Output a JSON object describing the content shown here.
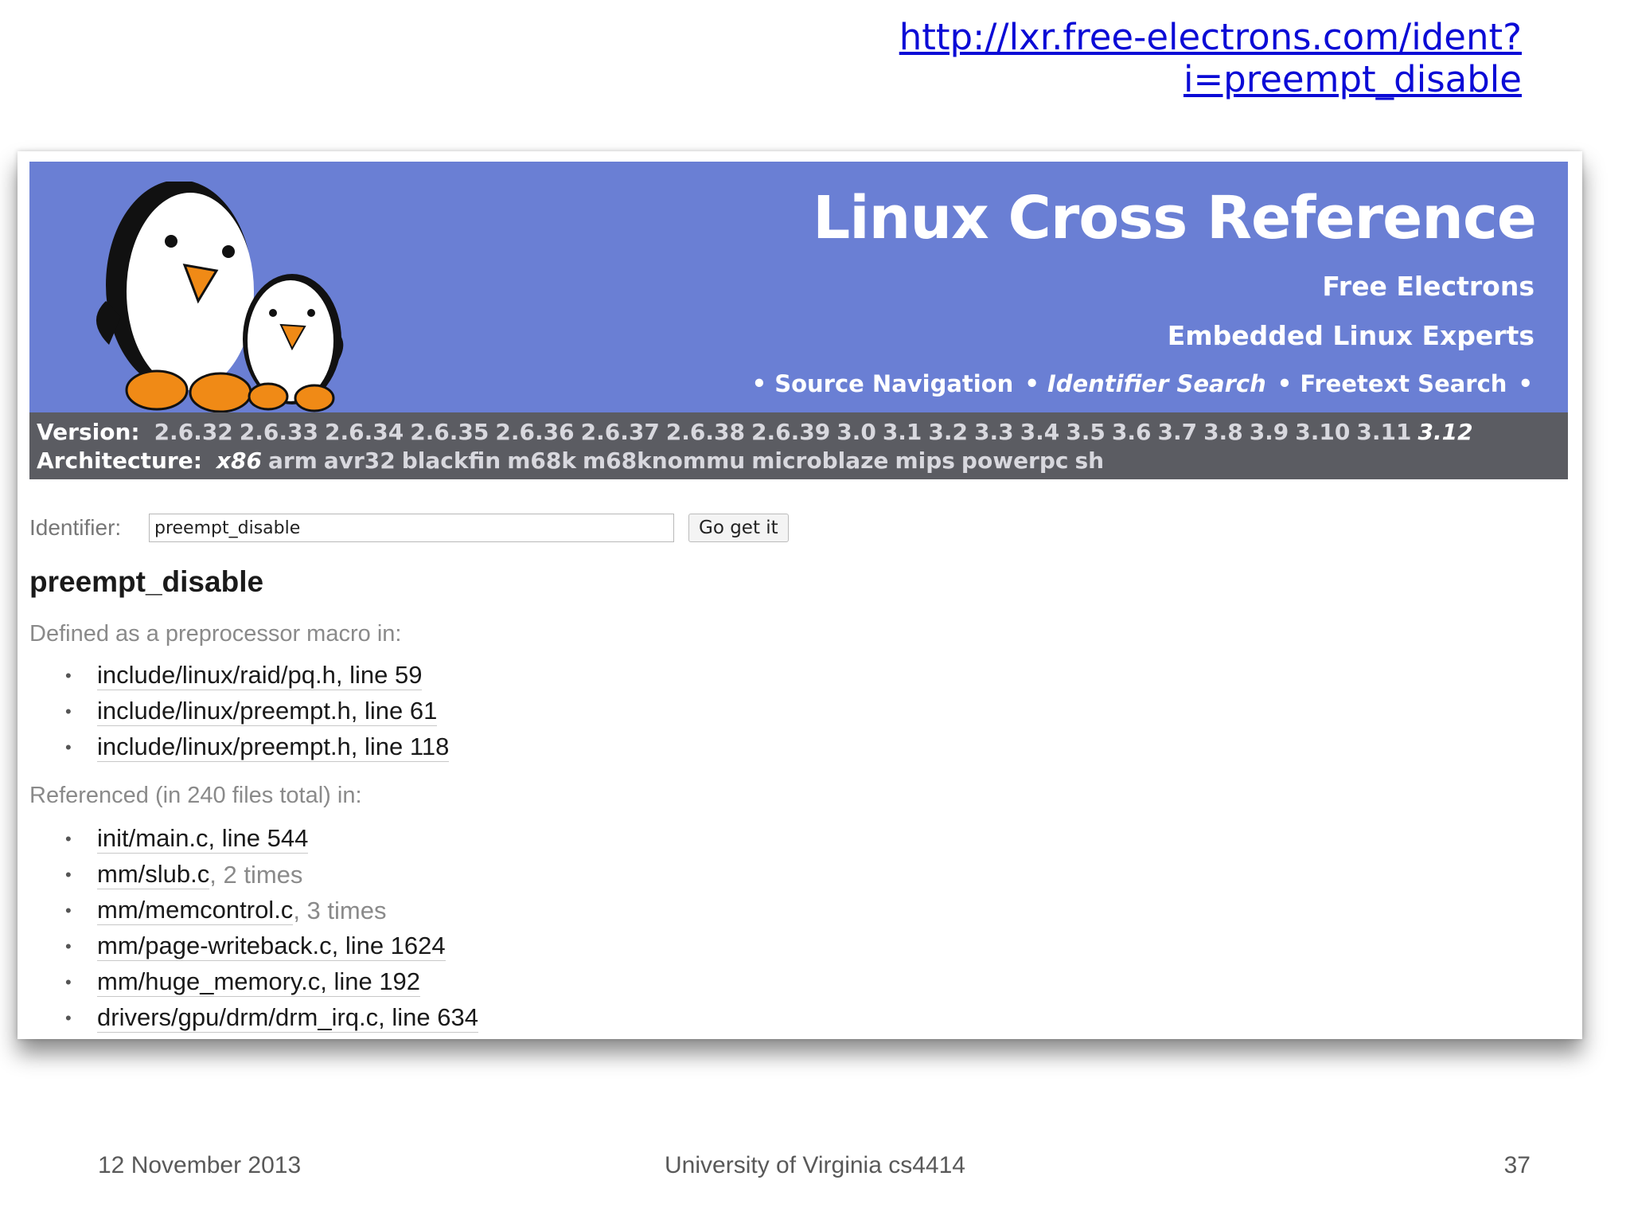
{
  "slide": {
    "url": "http://lxr.free-electrons.com/ident?i=preempt_disable",
    "footer": {
      "date": "12 November 2013",
      "center": "University of Virginia cs4414",
      "page": "37"
    }
  },
  "banner": {
    "title": "Linux Cross Reference",
    "sub1": "Free Electrons",
    "sub2": "Embedded Linux Experts",
    "nav": [
      "• Source Navigation",
      "• Identifier Search",
      "• Freetext Search",
      "•"
    ],
    "bg_color": "#6a7fd4",
    "logo_icon": "penguins-logo"
  },
  "version_bar": {
    "version_label": "Version:",
    "versions": [
      "2.6.32",
      "2.6.33",
      "2.6.34",
      "2.6.35",
      "2.6.36",
      "2.6.37",
      "2.6.38",
      "2.6.39",
      "3.0",
      "3.1",
      "3.2",
      "3.3",
      "3.4",
      "3.5",
      "3.6",
      "3.7",
      "3.8",
      "3.9",
      "3.10",
      "3.11",
      "3.12"
    ],
    "selected_version": "3.12",
    "arch_label": "Architecture:",
    "architectures": [
      "x86",
      "arm",
      "avr32",
      "blackfin",
      "m68k",
      "m68knommu",
      "microblaze",
      "mips",
      "powerpc",
      "sh"
    ],
    "selected_arch": "x86"
  },
  "search": {
    "label": "Identifier:",
    "value": "preempt_disable",
    "button": "Go get it"
  },
  "results": {
    "heading": "preempt_disable",
    "defined_label": "Defined as a preprocessor macro in:",
    "defined": [
      {
        "link": "include/linux/raid/pq.h, line 59",
        "extra": ""
      },
      {
        "link": "include/linux/preempt.h, line 61",
        "extra": ""
      },
      {
        "link": "include/linux/preempt.h, line 118",
        "extra": ""
      }
    ],
    "referenced_label": "Referenced (in 240 files total) in:",
    "referenced": [
      {
        "link": "init/main.c, line 544",
        "extra": ""
      },
      {
        "link": "mm/slub.c",
        "extra": ", 2 times"
      },
      {
        "link": "mm/memcontrol.c",
        "extra": ", 3 times"
      },
      {
        "link": "mm/page-writeback.c, line 1624",
        "extra": ""
      },
      {
        "link": "mm/huge_memory.c, line 192",
        "extra": ""
      },
      {
        "link": "drivers/gpu/drm/drm_irq.c, line 634",
        "extra": ""
      }
    ]
  }
}
